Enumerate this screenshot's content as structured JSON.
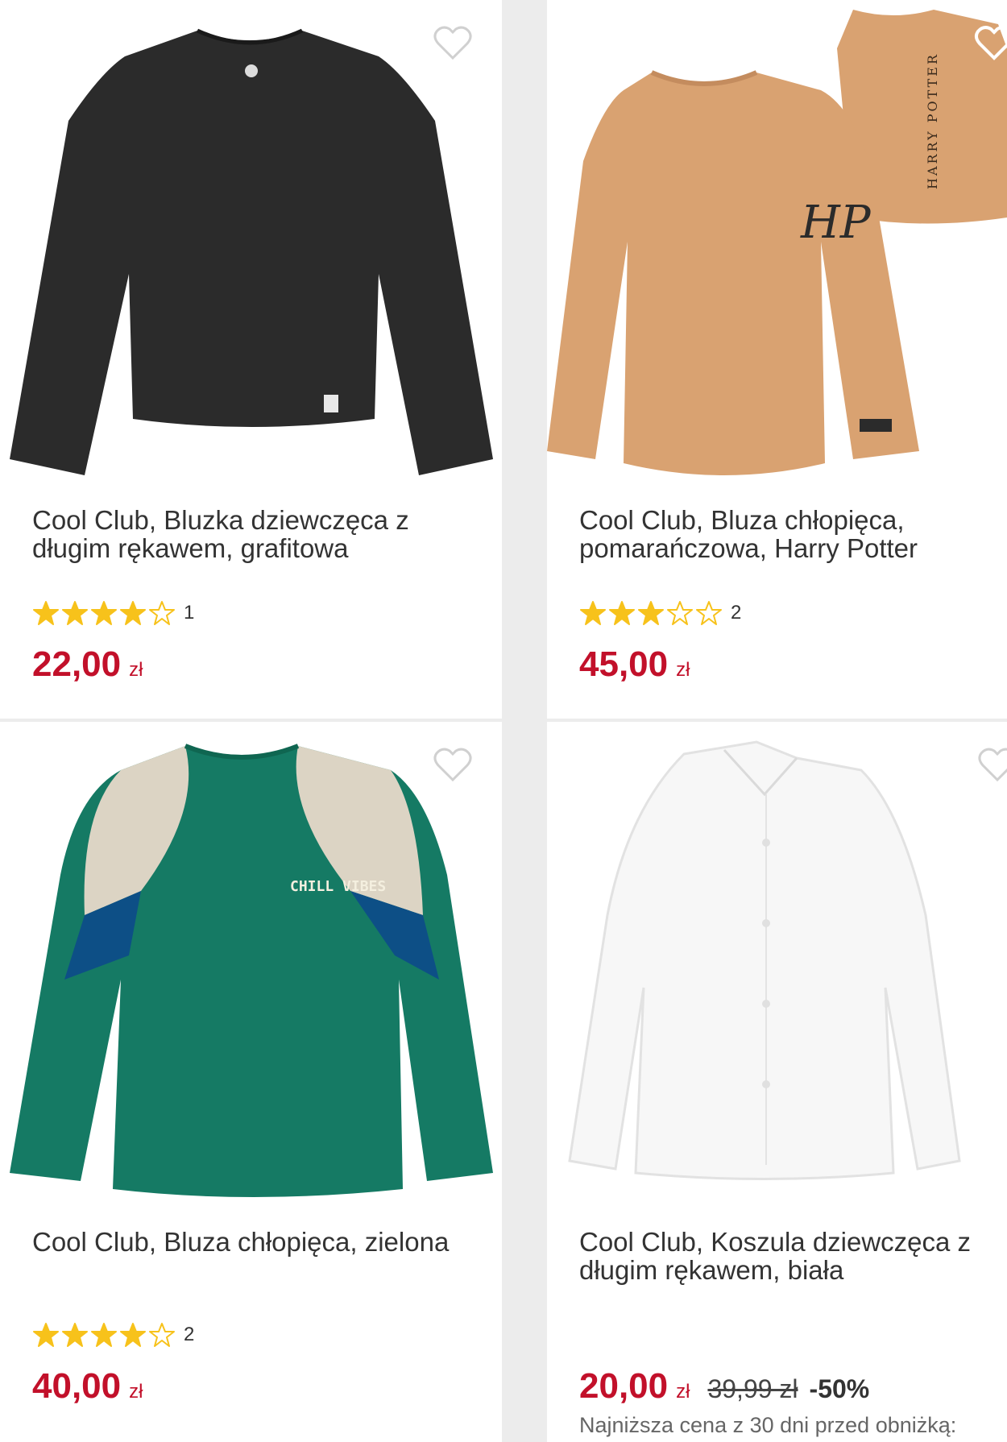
{
  "products": [
    {
      "title": "Cool Club, Bluzka dziewczęca z długim rękawem, grafitowa",
      "rating": 4,
      "rating_count": "1",
      "price": "22,00",
      "currency": "zł",
      "image_icon": "black-longsleeve-top-image",
      "image_color": "#2b2b2b"
    },
    {
      "title": "Cool Club, Bluza chłopięca, pomarańczowa, Harry Potter",
      "rating": 3,
      "rating_count": "2",
      "price": "45,00",
      "currency": "zł",
      "image_icon": "orange-harry-potter-sweatshirt-image",
      "image_color": "#d9a271",
      "image_print": "HARRY POTTER",
      "image_logo": "HP"
    },
    {
      "title": "Cool Club, Bluza chłopięca, zielona",
      "rating": 4,
      "rating_count": "2",
      "price": "40,00",
      "currency": "zł",
      "image_icon": "green-sweatshirt-image",
      "image_color": "#157a64",
      "image_print": "CHILL VIBES"
    },
    {
      "title": "Cool Club, Koszula dziewczęca z długim rękawem, biała",
      "price": "20,00",
      "currency": "zł",
      "old_price": "39,99 zł",
      "discount": "-50%",
      "lowest_price_note": "Najniższa cena z 30 dni przed obniżką:",
      "image_icon": "white-shirt-image",
      "image_color": "#f7f7f7"
    }
  ],
  "colors": {
    "price": "#c2102a",
    "star_filled": "#f7c21b",
    "star_outline": "#f7c21b",
    "background": "#ececec"
  },
  "icons": {
    "favorite": "heart-outline-icon",
    "star_filled": "star-filled-icon",
    "star_empty": "star-outline-icon"
  }
}
